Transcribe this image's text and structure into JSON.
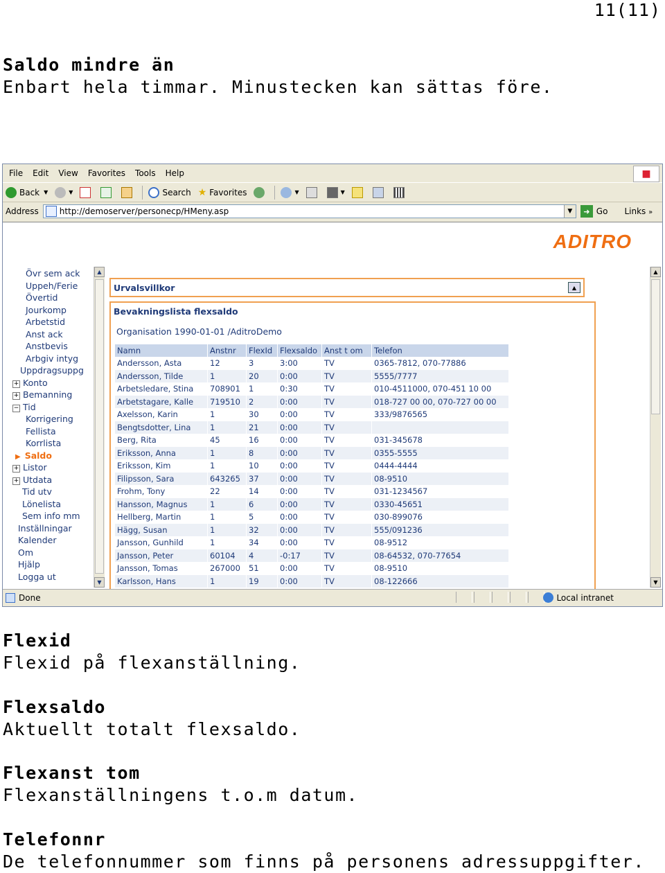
{
  "page_number": "11(11)",
  "intro": {
    "heading": "Saldo mindre än",
    "text": "Enbart hela timmar. Minustecken kan sättas före."
  },
  "browser": {
    "menu": [
      "File",
      "Edit",
      "View",
      "Favorites",
      "Tools",
      "Help"
    ],
    "toolbar": {
      "back": "Back",
      "search": "Search",
      "favorites": "Favorites"
    },
    "address": {
      "label": "Address",
      "url": "http://demoserver/personecp/HMeny.asp",
      "go": "Go",
      "links": "Links"
    },
    "status": {
      "text": "Done",
      "zone": "Local intranet"
    }
  },
  "app": {
    "logo": "ADITRO",
    "nav": [
      {
        "label": "Övr sem ack"
      },
      {
        "label": "Uppeh/Ferie"
      },
      {
        "label": "Övertid"
      },
      {
        "label": "Jourkomp"
      },
      {
        "label": "Arbetstid"
      },
      {
        "label": "Anst ack"
      },
      {
        "label": "Anstbevis"
      },
      {
        "label": "Arbgiv intyg"
      },
      {
        "label": "Uppdragsuppg"
      },
      {
        "label": "Konto"
      },
      {
        "label": "Bemanning"
      },
      {
        "label": "Tid"
      },
      {
        "label": "Korrigering"
      },
      {
        "label": "Fellista"
      },
      {
        "label": "Korrlista"
      },
      {
        "label": "Saldo"
      },
      {
        "label": "Listor"
      },
      {
        "label": "Utdata"
      },
      {
        "label": "Tid utv"
      },
      {
        "label": "Lönelista"
      },
      {
        "label": "Sem info mm"
      },
      {
        "label": "Inställningar"
      },
      {
        "label": "Kalender"
      },
      {
        "label": "Om"
      },
      {
        "label": "Hjälp"
      },
      {
        "label": "Logga ut"
      }
    ],
    "panel_criteria": "Urvalsvillkor",
    "panel_list": "Bevakningslista flexsaldo",
    "organisation": "Organisation 1990-01-01 /AditroDemo",
    "table": {
      "headers": [
        "Namn",
        "Anstnr",
        "FlexId",
        "Flexsaldo",
        "Anst t om",
        "Telefon"
      ],
      "rows": [
        [
          "Andersson, Asta",
          "12",
          "3",
          "3:00",
          "TV",
          "0365-7812, 070-77886"
        ],
        [
          "Andersson, Tilde",
          "1",
          "20",
          "0:00",
          "TV",
          "5555/7777"
        ],
        [
          "Arbetsledare, Stina",
          "708901",
          "1",
          "0:30",
          "TV",
          "010-4511000, 070-451 10 00"
        ],
        [
          "Arbetstagare, Kalle",
          "719510",
          "2",
          "0:00",
          "TV",
          "018-727 00 00, 070-727 00 00"
        ],
        [
          "Axelsson, Karin",
          "1",
          "30",
          "0:00",
          "TV",
          "333/9876565"
        ],
        [
          "Bengtsdotter, Lina",
          "1",
          "21",
          "0:00",
          "TV",
          ""
        ],
        [
          "Berg, Rita",
          "45",
          "16",
          "0:00",
          "TV",
          "031-345678"
        ],
        [
          "Eriksson, Anna",
          "1",
          "8",
          "0:00",
          "TV",
          "0355-5555"
        ],
        [
          "Eriksson, Kim",
          "1",
          "10",
          "0:00",
          "TV",
          "0444-4444"
        ],
        [
          "Filipsson, Sara",
          "643265",
          "37",
          "0:00",
          "TV",
          "08-9510"
        ],
        [
          "Frohm, Tony",
          "22",
          "14",
          "0:00",
          "TV",
          "031-1234567"
        ],
        [
          "Hansson, Magnus",
          "1",
          "6",
          "0:00",
          "TV",
          "0330-45651"
        ],
        [
          "Hellberg, Martin",
          "1",
          "5",
          "0:00",
          "TV",
          "030-899076"
        ],
        [
          "Hägg, Susan",
          "1",
          "32",
          "0:00",
          "TV",
          "555/091236"
        ],
        [
          "Jansson, Gunhild",
          "1",
          "34",
          "0:00",
          "TV",
          "08-9512"
        ],
        [
          "Jansson, Peter",
          "60104",
          "4",
          "-0:17",
          "TV",
          "08-64532, 070-77654"
        ],
        [
          "Jansson, Tomas",
          "267000",
          "51",
          "0:00",
          "TV",
          "08-9510"
        ],
        [
          "Karlsson, Hans",
          "1",
          "19",
          "0:00",
          "TV",
          "08-122666"
        ]
      ]
    }
  },
  "definitions": [
    {
      "term": "Flexid",
      "desc": "Flexid på flexanställning."
    },
    {
      "term": "Flexsaldo",
      "desc": "Aktuellt totalt flexsaldo."
    },
    {
      "term": "Flexanst tom",
      "desc": "Flexanställningens t.o.m datum."
    },
    {
      "term": "Telefonnr",
      "desc": "De telefonnummer som finns på personens adressuppgifter."
    }
  ]
}
